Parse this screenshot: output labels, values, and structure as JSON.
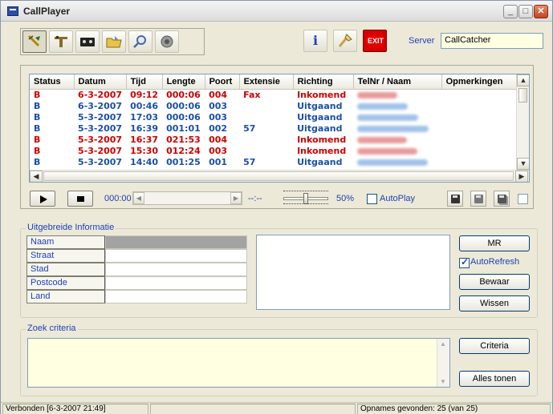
{
  "window": {
    "title": "CallPlayer",
    "minimize": "_",
    "maximize": "□",
    "close": "✕"
  },
  "toolbar": {
    "left_tools": [
      {
        "name": "antenna-icon",
        "glyph": "✎"
      },
      {
        "name": "phone-icon",
        "glyph": "☎"
      },
      {
        "name": "cassette-icon",
        "glyph": "▣"
      },
      {
        "name": "folder-icon",
        "glyph": "🗀"
      },
      {
        "name": "search-icon",
        "glyph": "⚲"
      },
      {
        "name": "speaker-icon",
        "glyph": "◉"
      }
    ],
    "info_glyph": "i",
    "settings_glyph": "⚙",
    "exit_label": "EXIT"
  },
  "server": {
    "label": "Server",
    "value": "CallCatcher"
  },
  "calls": {
    "columns": [
      "Status",
      "Datum",
      "Tijd",
      "Lengte",
      "Poort",
      "Extensie",
      "Richting",
      "TelNr / Naam",
      "Opmerkingen"
    ],
    "rows": [
      {
        "status": "B",
        "datum": "6-3-2007",
        "tijd": "09:12",
        "lengte": "000:06",
        "poort": "004",
        "extensie": "Fax",
        "richting": "Inkomend",
        "telnr": "",
        "opmerkingen": "",
        "color": "#cc0000"
      },
      {
        "status": "B",
        "datum": "6-3-2007",
        "tijd": "00:46",
        "lengte": "000:06",
        "poort": "003",
        "extensie": "",
        "richting": "Uitgaand",
        "telnr": "",
        "opmerkingen": "",
        "color": "#1a4fa8"
      },
      {
        "status": "B",
        "datum": "5-3-2007",
        "tijd": "17:03",
        "lengte": "000:06",
        "poort": "003",
        "extensie": "",
        "richting": "Uitgaand",
        "telnr": "",
        "opmerkingen": "",
        "color": "#1a4fa8"
      },
      {
        "status": "B",
        "datum": "5-3-2007",
        "tijd": "16:39",
        "lengte": "001:01",
        "poort": "002",
        "extensie": "57",
        "richting": "Uitgaand",
        "telnr": "",
        "opmerkingen": "",
        "color": "#1a4fa8"
      },
      {
        "status": "B",
        "datum": "5-3-2007",
        "tijd": "16:37",
        "lengte": "021:53",
        "poort": "004",
        "extensie": "",
        "richting": "Inkomend",
        "telnr": "",
        "opmerkingen": "",
        "color": "#cc0000"
      },
      {
        "status": "B",
        "datum": "5-3-2007",
        "tijd": "15:30",
        "lengte": "012:24",
        "poort": "003",
        "extensie": "",
        "richting": "Inkomend",
        "telnr": "",
        "opmerkingen": "",
        "color": "#cc0000"
      },
      {
        "status": "B",
        "datum": "5-3-2007",
        "tijd": "14:40",
        "lengte": "001:25",
        "poort": "001",
        "extensie": "57",
        "richting": "Uitgaand",
        "telnr": "",
        "opmerkingen": "",
        "color": "#1a4fa8"
      }
    ]
  },
  "player": {
    "time": "000:00",
    "position": "--:--",
    "volume_pct": "50%",
    "volume_level": 0.5,
    "autoplay_label": "AutoPlay",
    "autoplay_checked": false
  },
  "info": {
    "legend": "Uitgebreide Informatie",
    "fields": [
      "Naam",
      "Straat",
      "Stad",
      "Postcode",
      "Land"
    ],
    "mr_label": "MR",
    "autorefresh_label": "AutoRefresh",
    "autorefresh_checked": true,
    "bewaar_label": "Bewaar",
    "wissen_label": "Wissen"
  },
  "zoek": {
    "legend": "Zoek criteria",
    "criteria_label": "Criteria",
    "alles_label": "Alles tonen"
  },
  "status": {
    "connection": "Verbonden [6-3-2007 21:49]",
    "middle": "",
    "recordings": "Opnames gevonden: 25 (van 25)"
  },
  "colors": {
    "incoming": "#cc0000",
    "outgoing": "#1a4fa8",
    "label_blue": "#1f3fb6",
    "window_bg": "#ece9d8"
  }
}
